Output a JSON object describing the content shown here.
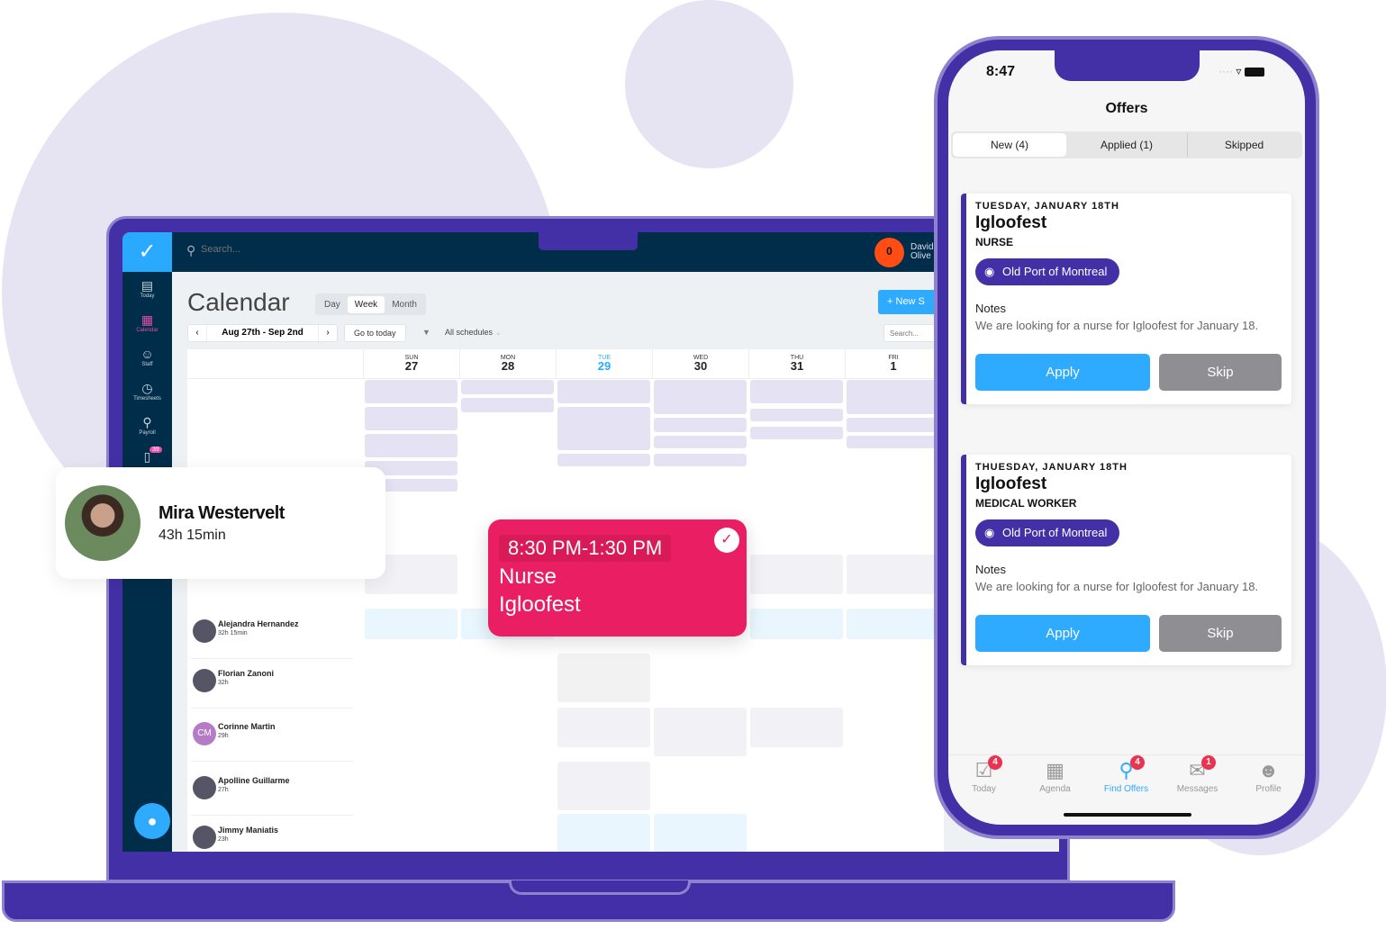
{
  "colors": {
    "brand": "#4330a6",
    "accent": "#29aaff",
    "shift_popup": "#e91e63",
    "sidebar": "#002d4a"
  },
  "laptop": {
    "search_placeholder": "Search...",
    "user": {
      "name_line1": "David",
      "name_line2": "Olive"
    },
    "sidebar": [
      {
        "label": "Today",
        "icon": "board-icon"
      },
      {
        "label": "Calendar",
        "icon": "calendar-icon"
      },
      {
        "label": "Staff",
        "icon": "staff-icon"
      },
      {
        "label": "Timesheets",
        "icon": "clock-icon"
      },
      {
        "label": "Payroll",
        "icon": "network-icon"
      },
      {
        "label": "",
        "icon": "document-icon",
        "badge": "39"
      }
    ],
    "title": "Calendar",
    "views": [
      "Day",
      "Week",
      "Month"
    ],
    "active_view": "Week",
    "date_range": "Aug 27th - Sep 2nd",
    "go_today": "Go to today",
    "filter": "All schedules",
    "new_button": "New S",
    "search2": "Search...",
    "days": [
      {
        "d": "SUN",
        "n": "27"
      },
      {
        "d": "MON",
        "n": "28"
      },
      {
        "d": "TUE",
        "n": "29",
        "today": true
      },
      {
        "d": "WED",
        "n": "30"
      },
      {
        "d": "THU",
        "n": "31"
      },
      {
        "d": "FRI",
        "n": "1"
      }
    ],
    "staff": [
      {
        "name": "Alejandra Hernandez",
        "hours": "32h 15min"
      },
      {
        "name": "Florian Zanoni",
        "hours": "32h"
      },
      {
        "name": "Corinne Martin",
        "hours": "29h",
        "initials": "CM"
      },
      {
        "name": "Apolline Guillarme",
        "hours": "27h"
      },
      {
        "name": "Jimmy Maniatis",
        "hours": "23h"
      }
    ]
  },
  "profile_card": {
    "name": "Mira Westervelt",
    "hours": "43h 15min"
  },
  "shift_popup": {
    "time": "8:30 PM-1:30 PM",
    "role": "Nurse",
    "event": "Igloofest"
  },
  "phone": {
    "time": "8:47",
    "title": "Offers",
    "tabs": [
      "New (4)",
      "Applied (1)",
      "Skipped"
    ],
    "offers": [
      {
        "date": "TUESDAY, JANUARY 18TH",
        "title": "Igloofest",
        "role": "NURSE",
        "location": "Old Port of Montreal",
        "notes_label": "Notes",
        "notes": "We are looking for a nurse for Igloofest for January 18.",
        "apply": "Apply",
        "skip": "Skip"
      },
      {
        "date": "THUESDAY, JANUARY 18TH",
        "title": "Igloofest",
        "role": "MEDICAL WORKER",
        "location": "Old Port of Montreal",
        "notes_label": "Notes",
        "notes": "We are looking for a nurse for Igloofest for January 18.",
        "apply": "Apply",
        "skip": "Skip"
      }
    ],
    "nav": [
      {
        "label": "Today",
        "icon": "checkbox-icon",
        "badge": "4"
      },
      {
        "label": "Agenda",
        "icon": "agenda-icon"
      },
      {
        "label": "Find Offers",
        "icon": "search-icon",
        "badge": "4",
        "active": true
      },
      {
        "label": "Messages",
        "icon": "chat-icon",
        "badge": "1"
      },
      {
        "label": "Profile",
        "icon": "profile-icon"
      }
    ]
  }
}
